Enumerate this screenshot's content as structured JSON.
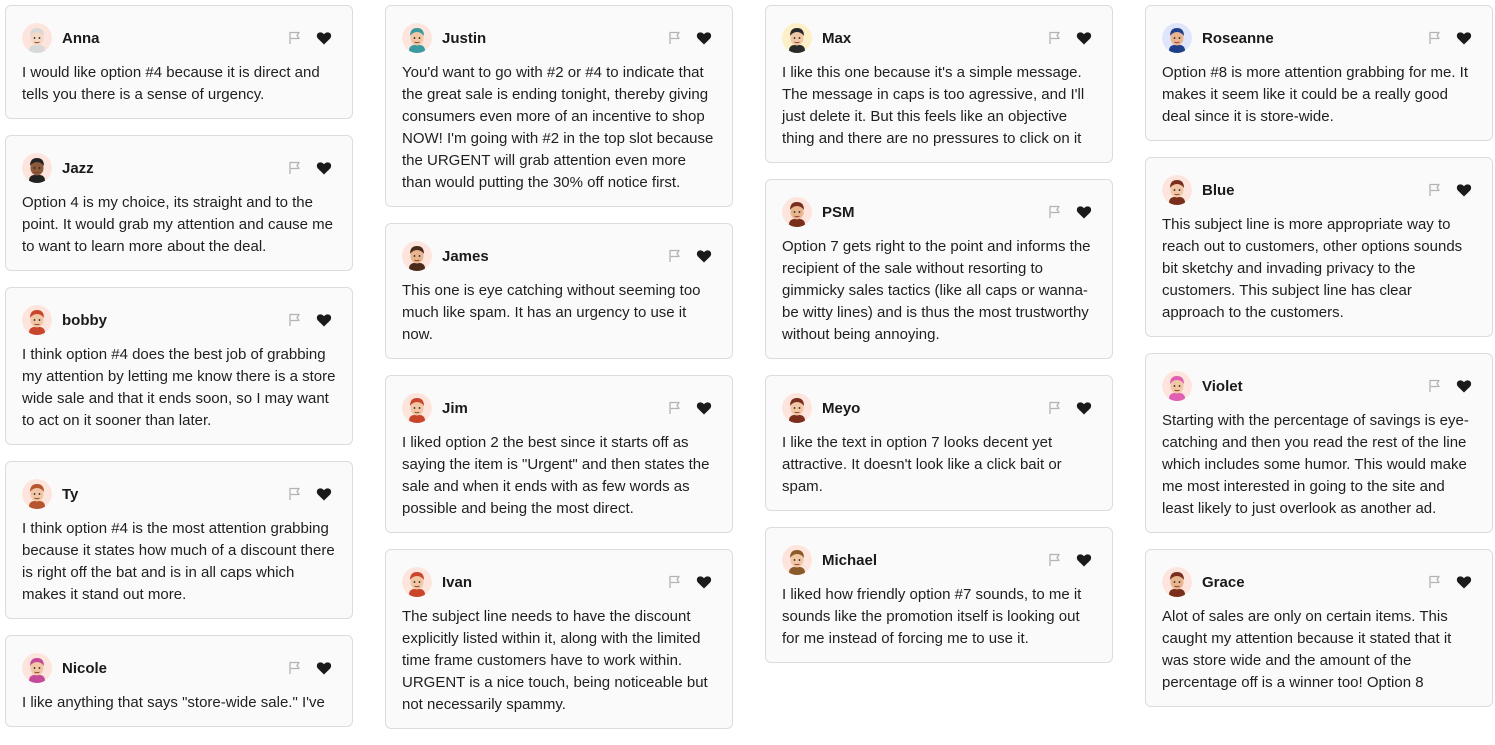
{
  "columns": [
    {
      "cards": [
        {
          "name": "Anna",
          "text": "I would like option #4 because it is direct and tells you there is a sense of urgency.",
          "avatar": {
            "skin": "#f3d9c6",
            "hair": "#d9d9d9",
            "bg": "#fde4dc"
          }
        },
        {
          "name": "Jazz",
          "text": "Option 4 is my choice, its straight and to the point. It would grab my attention and cause me to want to learn more about the deal.",
          "avatar": {
            "skin": "#8a5a3b",
            "hair": "#222222",
            "bg": "#fde4dc"
          }
        },
        {
          "name": "bobby",
          "text": "I think option #4 does the best job of grabbing my attention by letting me know there is a store wide sale and that it ends soon, so I may want to act on it sooner than later.",
          "avatar": {
            "skin": "#f1c7a6",
            "hair": "#c9462c",
            "bg": "#fde4dc"
          }
        },
        {
          "name": "Ty",
          "text": "I think option #4 is the most attention grabbing because it states how much of a discount there is right off the bat and is in all caps which makes it stand out more.",
          "avatar": {
            "skin": "#f1c7a6",
            "hair": "#b5562f",
            "bg": "#fde4dc"
          }
        },
        {
          "name": "Nicole",
          "text": "I like anything that says \"store-wide sale.\" I've",
          "avatar": {
            "skin": "#f1c7a6",
            "hair": "#c44a9a",
            "bg": "#fde4dc"
          }
        }
      ]
    },
    {
      "cards": [
        {
          "name": "Justin",
          "text": "You'd want to go with #2 or #4 to indicate that the great sale is ending tonight, thereby giving consumers even more of an incentive to shop NOW! I'm going with #2 in the top slot because the URGENT will grab attention even more than would putting the 30% off notice first.",
          "avatar": {
            "skin": "#f1c7a6",
            "hair": "#3a9aa0",
            "bg": "#fde4dc"
          }
        },
        {
          "name": "James",
          "text": "This one is eye catching without seeming too much like spam. It has an urgency to use it now.",
          "avatar": {
            "skin": "#e9b58f",
            "hair": "#4a2a1a",
            "bg": "#fde4dc"
          }
        },
        {
          "name": "Jim",
          "text": "I liked option 2 the best since it starts off as saying the item is \"Urgent\" and then states the sale and when it ends with as few words as possible and being the most direct.",
          "avatar": {
            "skin": "#f1c7a6",
            "hair": "#c9462c",
            "bg": "#fde4dc"
          }
        },
        {
          "name": "Ivan",
          "text": "The subject line needs to have the discount explicitly listed within it, along with the limited time frame customers have to work within. URGENT is a nice touch, being noticeable but not necessarily spammy.",
          "avatar": {
            "skin": "#f1c7a6",
            "hair": "#c9462c",
            "bg": "#fde4dc"
          }
        }
      ]
    },
    {
      "cards": [
        {
          "name": "Max",
          "text": "I like this one because it's a simple message. The message in caps is too agressive, and I'll just delete it. But this feels like an objective thing and there are no pressures to click on it",
          "avatar": {
            "skin": "#f1c7a6",
            "hair": "#2a2a2a",
            "bg": "#fdf0c8"
          }
        },
        {
          "name": "PSM",
          "text": "Option 7 gets right to the point and informs the recipient of the sale without resorting to gimmicky sales tactics (like all caps or wanna-be witty lines) and is thus the most trustworthy without being annoying.",
          "avatar": {
            "skin": "#e9b58f",
            "hair": "#7a2e1e",
            "bg": "#fde4dc"
          }
        },
        {
          "name": "Meyo",
          "text": "I like the text in option 7 looks decent yet attractive. It doesn't look like a click bait or spam.",
          "avatar": {
            "skin": "#f1c7a6",
            "hair": "#7a2e1e",
            "bg": "#fde4dc"
          }
        },
        {
          "name": "Michael",
          "text": "I liked how friendly option #7 sounds, to me it sounds like the promotion itself is looking out for me instead of forcing me to use it.",
          "avatar": {
            "skin": "#f1c7a6",
            "hair": "#8a5a2b",
            "bg": "#fde4dc"
          }
        }
      ]
    },
    {
      "cards": [
        {
          "name": "Roseanne",
          "text": "Option #8 is more attention grabbing for me. It makes it seem like it could be a really good deal since it is store-wide.",
          "avatar": {
            "skin": "#e9b58f",
            "hair": "#1f3f8a",
            "bg": "#dfe6fb"
          }
        },
        {
          "name": "Blue",
          "text": "This subject line is more appropriate way to reach out to customers, other options sounds bit sketchy and invading privacy to the customers. This subject line has clear approach to the customers.",
          "avatar": {
            "skin": "#f1c7a6",
            "hair": "#7a2e1e",
            "bg": "#fde4dc"
          }
        },
        {
          "name": "Violet",
          "text": "Starting with the percentage of savings is eye-catching and then you read the rest of the line which includes some humor. This would make me most interested in going to the site and least likely to just overlook as another ad.",
          "avatar": {
            "skin": "#f1c7a6",
            "hair": "#e05fb0",
            "bg": "#fde4dc"
          }
        },
        {
          "name": "Grace",
          "text": "Alot of sales are only on certain items. This caught my attention because it stated that it was store wide and the amount of the percentage off is a winner too! Option 8",
          "avatar": {
            "skin": "#e9b58f",
            "hair": "#7a2e1e",
            "bg": "#fde4dc"
          }
        }
      ]
    }
  ],
  "colors": {
    "card_bg": "#fafafa",
    "border": "#dcdcdc",
    "text": "#1f1f1f",
    "flag": "#b3b3b3",
    "heart": "#1a1a1a"
  },
  "icons": {
    "flag": "flag-icon",
    "heart": "heart-icon"
  }
}
